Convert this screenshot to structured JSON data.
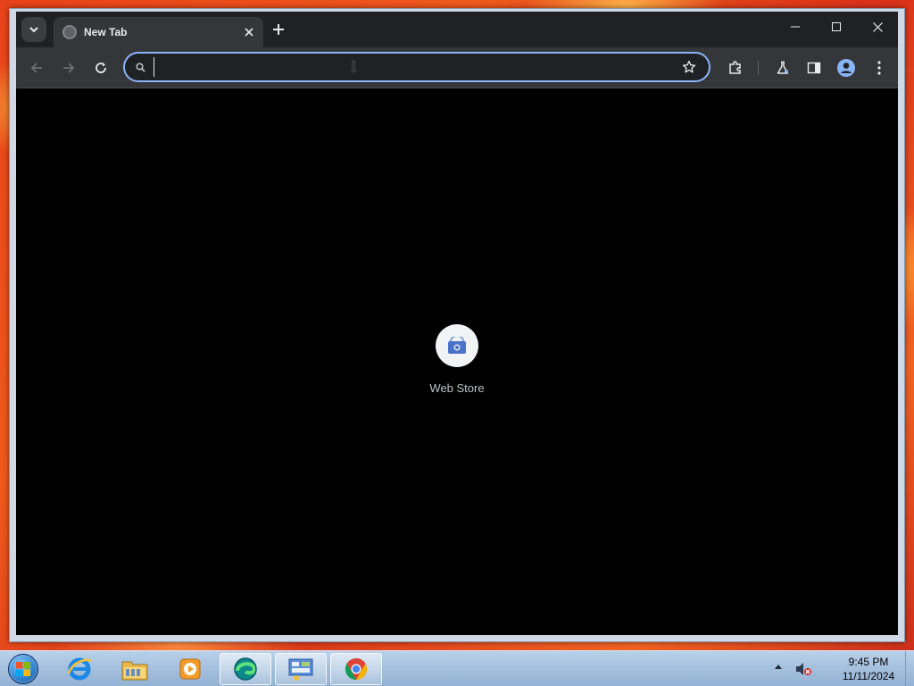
{
  "browser": {
    "tab": {
      "title": "New Tab"
    },
    "omnibox": {
      "value": "",
      "placeholder": ""
    },
    "shortcuts": [
      {
        "label": "Web Store"
      }
    ]
  },
  "taskbar": {
    "clock": {
      "time": "9:45 PM",
      "date": "11/11/2024"
    },
    "items": [
      {
        "name": "internet-explorer"
      },
      {
        "name": "file-explorer"
      },
      {
        "name": "media-player"
      },
      {
        "name": "edge"
      },
      {
        "name": "control-panel"
      },
      {
        "name": "chrome"
      }
    ]
  },
  "colors": {
    "accent": "#8ab4f8",
    "tab_bg": "#35363a",
    "frame_bg": "#202124"
  }
}
